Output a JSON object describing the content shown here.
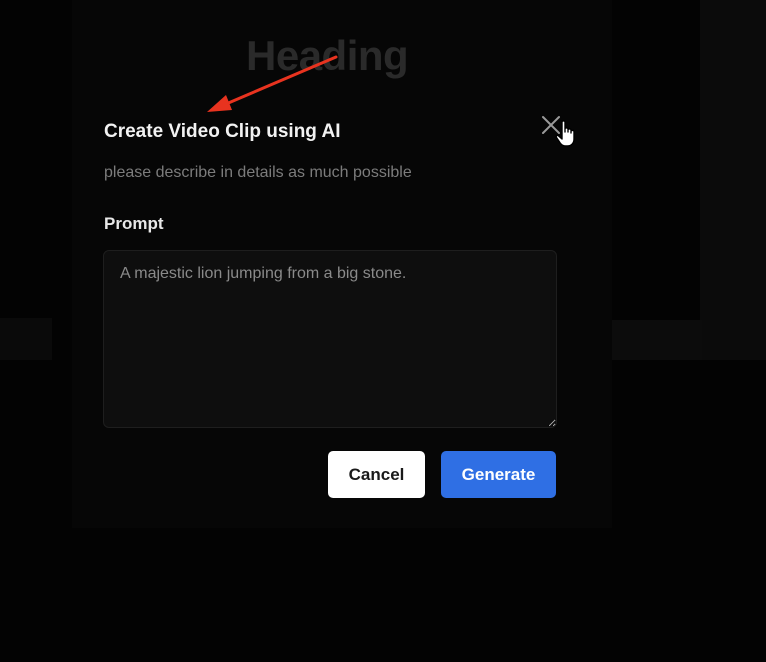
{
  "background": {
    "heading": "Heading"
  },
  "dialog": {
    "title": "Create Video Clip using AI",
    "subtitle": "please describe in details as much possible",
    "prompt_label": "Prompt",
    "prompt_value": "A majestic lion jumping from a big stone.",
    "cancel_label": "Cancel",
    "generate_label": "Generate",
    "close_icon": "close-icon"
  },
  "annotation": {
    "arrow_color": "#e8331f"
  },
  "colors": {
    "primary": "#2f6fe4",
    "surface": "#060606",
    "title": "#f2f2f2",
    "muted": "#7c7c7c"
  }
}
